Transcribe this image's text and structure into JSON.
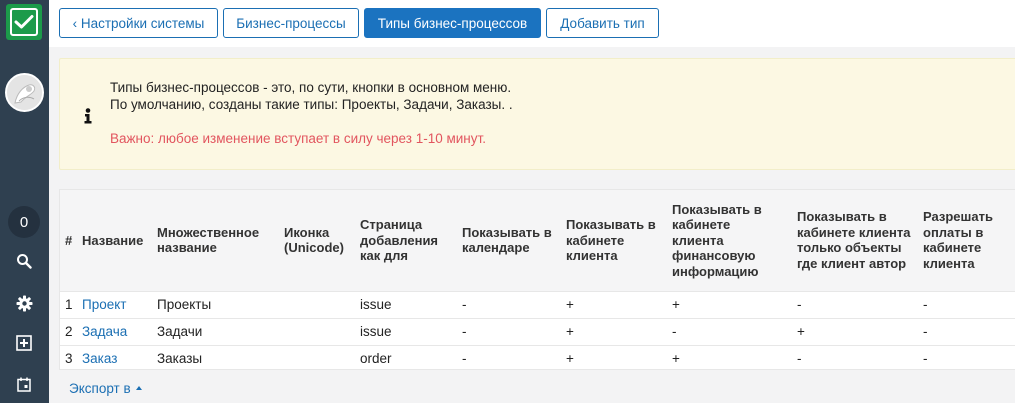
{
  "colors": {
    "sidebar": "#2f4050",
    "accent": "#1b73c0",
    "logo": "#1c9b4a",
    "warning_text": "#e2555f",
    "alert_bg": "#fcf8e3"
  },
  "sidebar": {
    "logo_icon": "checkbox-icon",
    "counter": "0",
    "icons": [
      "search-icon",
      "gear-icon",
      "plus-square-icon",
      "calendar-icon"
    ]
  },
  "nav": {
    "settings_label": "‹ Настройки системы",
    "processes_label": "Бизнес-процессы",
    "types_label": "Типы бизнес-процессов",
    "add_type_label": "Добавить тип"
  },
  "alert": {
    "line1": "Типы бизнес-процессов - это, по сути, кнопки в основном меню.",
    "line2": "По умолчанию, созданы такие типы: Проекты, Задачи, Заказы. .",
    "warning": "Важно: любое изменение вступает в силу через 1-10 минут."
  },
  "table": {
    "headers": {
      "num": "#",
      "name": "Название",
      "plural": "Множественное название",
      "icon": "Иконка (Unicode)",
      "page": "Страница добавления как для",
      "calendar": "Показывать в календаре",
      "cabinet": "Показывать в кабинете клиента",
      "finance": "Показывать в кабинете клиента финансовую информацию",
      "own_only": "Показывать в кабинете клиента только объекты где клиент автор",
      "payments": "Разрешать оплаты в кабинете клиента"
    },
    "rows": [
      {
        "num": "1",
        "name": "Проект",
        "plural": "Проекты",
        "icon": "",
        "page": "issue",
        "calendar": "-",
        "cabinet": "+",
        "finance": "+",
        "own_only": "-",
        "payments": "-"
      },
      {
        "num": "2",
        "name": "Задача",
        "plural": "Задачи",
        "icon": "",
        "page": "issue",
        "calendar": "-",
        "cabinet": "+",
        "finance": "-",
        "own_only": "+",
        "payments": "-"
      },
      {
        "num": "3",
        "name": "Заказ",
        "plural": "Заказы",
        "icon": "",
        "page": "order",
        "calendar": "-",
        "cabinet": "+",
        "finance": "+",
        "own_only": "-",
        "payments": "-"
      }
    ]
  },
  "export_label": "Экспорт в"
}
